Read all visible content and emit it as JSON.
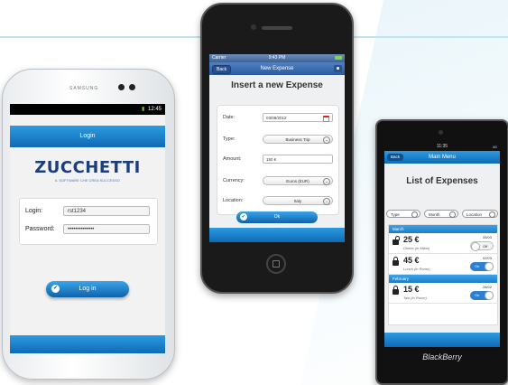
{
  "colors": {
    "accent": "#1a7fd0",
    "brand_blue": "#1b3f7a"
  },
  "phone1": {
    "brand": "SAMSUNG",
    "status_time": "12:45",
    "title": "Login",
    "logo_name": "ZUCCHETTI",
    "logo_tagline": "IL SOFTWARE CHE CREA SUCCESSO",
    "login_label": "Login:",
    "login_value": "rst1234",
    "password_label": "Password:",
    "password_value": "••••••••••••••",
    "login_button": "Log in",
    "login_button_icon": "check-icon"
  },
  "phone2": {
    "carrier": "Carrier",
    "time": "9:43 PM",
    "back": "Back",
    "nav_title": "New Expense",
    "heading": "Insert a new Expense",
    "date_label": "Date:",
    "date_value": "03/08/2012",
    "type_label": "Type:",
    "type_value": "Business Trip",
    "amount_label": "Amount:",
    "amount_value": "150 €",
    "currency_label": "Currency:",
    "currency_value": "Euros (EUR)",
    "location_label": "Location:",
    "location_value": "Italy",
    "ok_button": "Ok"
  },
  "phone3": {
    "time": "11:35",
    "signal": "4G",
    "back": "Back",
    "nav_title": "Main Menu",
    "heading": "List of Expenses",
    "filters": [
      "Type",
      "Month",
      "Location"
    ],
    "sections": [
      {
        "name": "March",
        "items": [
          {
            "amount": "25 €",
            "desc": "Dinner (in Milan)",
            "date": "05/03",
            "toggle": "Off",
            "locked": false
          },
          {
            "amount": "45 €",
            "desc": "Lunch (in Rome)",
            "date": "02/03",
            "toggle": "On",
            "locked": true
          }
        ]
      },
      {
        "name": "February",
        "items": [
          {
            "amount": "15 €",
            "desc": "Taxi (in Rome)",
            "date": "28/02",
            "toggle": "On",
            "locked": true
          }
        ]
      }
    ],
    "brand": "BlackBerry"
  }
}
